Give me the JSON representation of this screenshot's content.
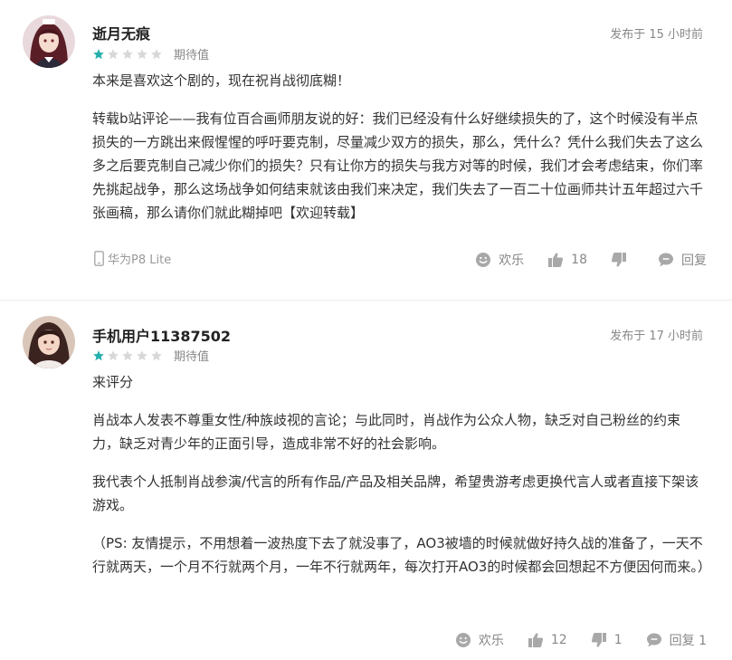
{
  "colors": {
    "star_filled": "#25b0ad",
    "star_empty": "#d8d8d8",
    "icon": "#a8a8a8"
  },
  "reviews": [
    {
      "username": "逝月无痕",
      "time": "发布于 15 小时前",
      "rating": 1,
      "rating_max": 5,
      "rating_label": "期待值",
      "paragraphs": [
        "本来是喜欢这个剧的，现在祝肖战彻底糊！",
        "转载b站评论——我有位百合画师朋友说的好：我们已经没有什么好继续损失的了，这个时候没有半点损失的一方跳出来假惺惺的呼吁要克制，尽量减少双方的损失，那么，凭什么？凭什么我们失去了这么多之后要克制自己减少你们的损失？只有让你方的损失与我方对等的时候，我们才会考虑结束，你们率先挑起战争，那么这场战争如何结束就该由我们来决定，我们失去了一百二十位画师共计五年超过六千张画稿，那么请你们就此糊掉吧【欢迎转载】"
      ],
      "device": "华为P8 Lite",
      "actions": {
        "like_label": "欢乐",
        "thumbs_up": "18",
        "thumbs_down": "",
        "reply_label": "回复"
      }
    },
    {
      "username": "手机用户11387502",
      "time": "发布于 17 小时前",
      "rating": 1,
      "rating_max": 5,
      "rating_label": "期待值",
      "paragraphs": [
        "来评分",
        "肖战本人发表不尊重女性/种族歧视的言论；与此同时，肖战作为公众人物，缺乏对自己粉丝的约束力，缺乏对青少年的正面引导，造成非常不好的社会影响。",
        "我代表个人抵制肖战参演/代言的所有作品/产品及相关品牌，希望贵游考虑更换代言人或者直接下架该游戏。",
        "（PS: 友情提示，不用想着一波热度下去了就没事了，AO3被墙的时候就做好持久战的准备了，一天不行就两天，一个月不行就两个月，一年不行就两年，每次打开AO3的时候都会回想起不方便因何而来。）"
      ],
      "device": "",
      "actions": {
        "like_label": "欢乐",
        "thumbs_up": "12",
        "thumbs_down": "1",
        "reply_label": "回复 1"
      }
    }
  ]
}
